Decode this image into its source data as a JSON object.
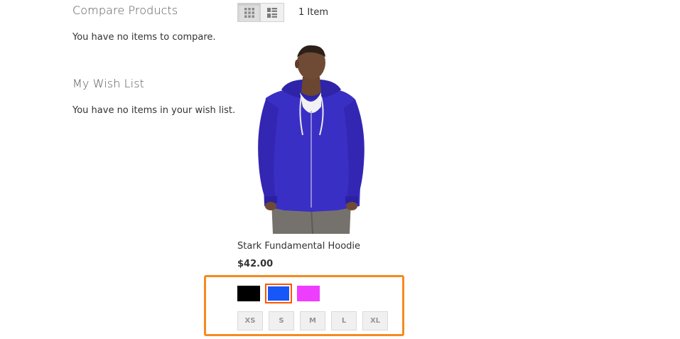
{
  "sidebar": {
    "compare": {
      "title": "Compare Products",
      "empty_text": "You have no items to compare."
    },
    "wishlist": {
      "title": "My Wish List",
      "empty_text": "You have no items in your wish list."
    }
  },
  "toolbar": {
    "view_modes": [
      {
        "icon": "grid-icon",
        "active": true
      },
      {
        "icon": "list-icon",
        "active": false
      }
    ],
    "amount": "1 Item"
  },
  "product": {
    "name": "Stark Fundamental Hoodie",
    "price": "$42.00",
    "colors": [
      {
        "name": "Black",
        "hex": "#000000",
        "selected": false
      },
      {
        "name": "Blue",
        "hex": "#1857f7",
        "selected": true
      },
      {
        "name": "Purple",
        "hex": "#ef3dff",
        "selected": false
      }
    ],
    "sizes": [
      "XS",
      "S",
      "M",
      "L",
      "XL"
    ]
  },
  "colors": {
    "highlight": "#f68a1e",
    "swatch_selected_outline": "#ff5501"
  }
}
